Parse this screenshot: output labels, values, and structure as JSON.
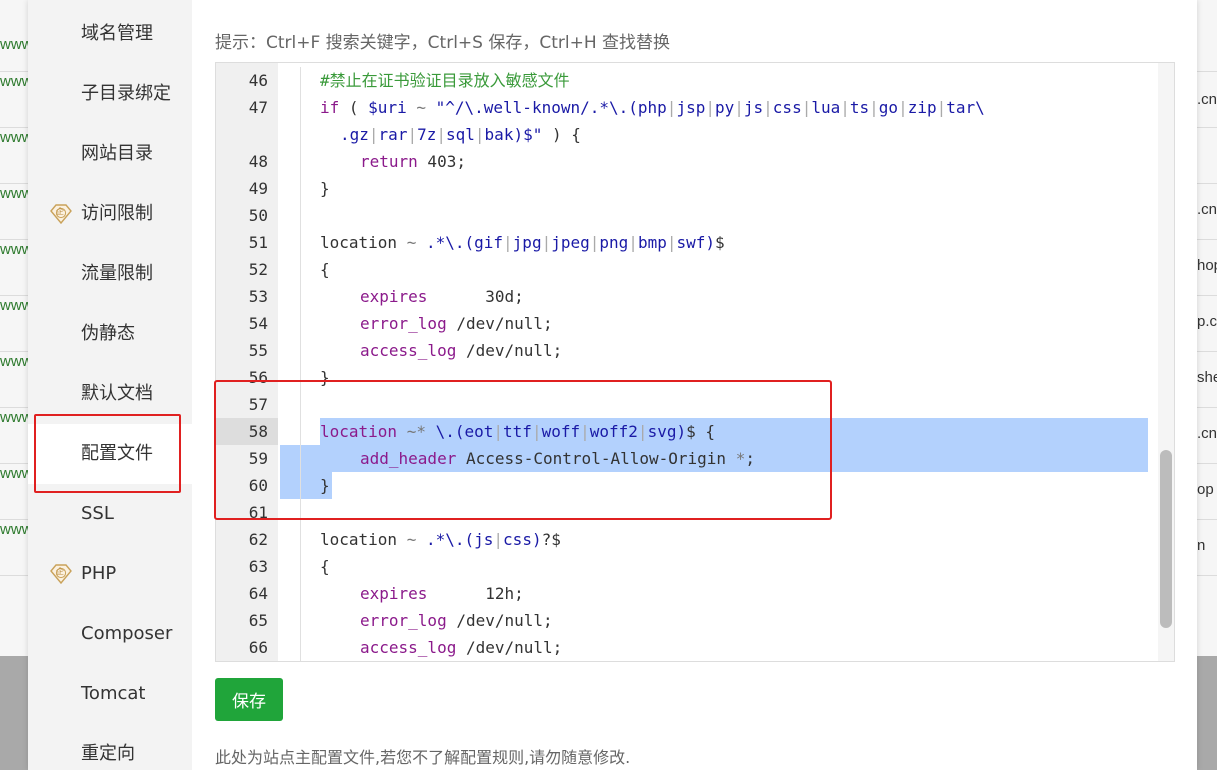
{
  "background": {
    "left_fragments": [
      "www",
      "www",
      "www",
      "www",
      "www",
      "www",
      "www",
      "www",
      "www",
      "www"
    ],
    "right_fragments": [
      ".cn",
      ".cn",
      "hop",
      "p.c",
      "she",
      ".cn",
      "op",
      "n"
    ]
  },
  "sidebar": {
    "items": [
      {
        "label": "域名管理",
        "premium": false,
        "active": false
      },
      {
        "label": "子目录绑定",
        "premium": false,
        "active": false
      },
      {
        "label": "网站目录",
        "premium": false,
        "active": false
      },
      {
        "label": "访问限制",
        "premium": true,
        "active": false
      },
      {
        "label": "流量限制",
        "premium": false,
        "active": false
      },
      {
        "label": "伪静态",
        "premium": false,
        "active": false
      },
      {
        "label": "默认文档",
        "premium": false,
        "active": false
      },
      {
        "label": "配置文件",
        "premium": false,
        "active": true
      },
      {
        "label": "SSL",
        "premium": false,
        "active": false
      },
      {
        "label": "PHP",
        "premium": true,
        "active": false
      },
      {
        "label": "Composer",
        "premium": false,
        "active": false
      },
      {
        "label": "Tomcat",
        "premium": false,
        "active": false
      },
      {
        "label": "重定向",
        "premium": false,
        "active": false
      }
    ],
    "premium_badge": "企"
  },
  "main": {
    "hint": "提示：Ctrl+F 搜索关键字，Ctrl+S 保存，Ctrl+H 查找替换",
    "save_label": "保存",
    "footnote": "此处为站点主配置文件,若您不了解配置规则,请勿随意修改."
  },
  "editor": {
    "current_line": "58",
    "lines": [
      {
        "no": "46",
        "indent": 0,
        "tokens": [
          [
            "comment",
            "#禁止在证书验证目录放入敏感文件"
          ]
        ]
      },
      {
        "no": "47",
        "indent": 0,
        "tokens": [
          [
            "kw",
            "if"
          ],
          [
            "def",
            " ( "
          ],
          [
            "var",
            "$uri"
          ],
          [
            "op",
            " ~ "
          ],
          [
            "str",
            "\"^/\\.well-known/.*\\.(php"
          ],
          [
            "pipe",
            "|"
          ],
          [
            "str",
            "jsp"
          ],
          [
            "pipe",
            "|"
          ],
          [
            "str",
            "py"
          ],
          [
            "pipe",
            "|"
          ],
          [
            "str",
            "js"
          ],
          [
            "pipe",
            "|"
          ],
          [
            "str",
            "css"
          ],
          [
            "pipe",
            "|"
          ],
          [
            "str",
            "lua"
          ],
          [
            "pipe",
            "|"
          ],
          [
            "str",
            "ts"
          ],
          [
            "pipe",
            "|"
          ],
          [
            "str",
            "go"
          ],
          [
            "pipe",
            "|"
          ],
          [
            "str",
            "zip"
          ],
          [
            "pipe",
            "|"
          ],
          [
            "str",
            "tar\\"
          ]
        ]
      },
      {
        "no": "",
        "indent": 0,
        "wrap": true,
        "tokens": [
          [
            "str",
            ".gz"
          ],
          [
            "pipe",
            "|"
          ],
          [
            "str",
            "rar"
          ],
          [
            "pipe",
            "|"
          ],
          [
            "str",
            "7z"
          ],
          [
            "pipe",
            "|"
          ],
          [
            "str",
            "sql"
          ],
          [
            "pipe",
            "|"
          ],
          [
            "str",
            "bak)$\""
          ],
          [
            "def",
            " ) {"
          ]
        ]
      },
      {
        "no": "48",
        "indent": 1,
        "tokens": [
          [
            "kw",
            "return"
          ],
          [
            "def",
            " 403;"
          ]
        ]
      },
      {
        "no": "49",
        "indent": 0,
        "tokens": [
          [
            "def",
            "}"
          ]
        ]
      },
      {
        "no": "50",
        "indent": 0,
        "tokens": []
      },
      {
        "no": "51",
        "indent": 0,
        "tokens": [
          [
            "def",
            "location"
          ],
          [
            "op",
            " ~ "
          ],
          [
            "str",
            ".*\\.(gif"
          ],
          [
            "pipe",
            "|"
          ],
          [
            "str",
            "jpg"
          ],
          [
            "pipe",
            "|"
          ],
          [
            "str",
            "jpeg"
          ],
          [
            "pipe",
            "|"
          ],
          [
            "str",
            "png"
          ],
          [
            "pipe",
            "|"
          ],
          [
            "str",
            "bmp"
          ],
          [
            "pipe",
            "|"
          ],
          [
            "str",
            "swf)"
          ],
          [
            "def",
            "$"
          ]
        ]
      },
      {
        "no": "52",
        "indent": 0,
        "tokens": [
          [
            "def",
            "{"
          ]
        ]
      },
      {
        "no": "53",
        "indent": 1,
        "tokens": [
          [
            "kw",
            "expires"
          ],
          [
            "def",
            "      30d;"
          ]
        ]
      },
      {
        "no": "54",
        "indent": 1,
        "tokens": [
          [
            "kw",
            "error_log"
          ],
          [
            "def",
            " /dev/null;"
          ]
        ]
      },
      {
        "no": "55",
        "indent": 1,
        "tokens": [
          [
            "kw",
            "access_log"
          ],
          [
            "def",
            " /dev/null;"
          ]
        ]
      },
      {
        "no": "56",
        "indent": 0,
        "tokens": [
          [
            "def",
            "}"
          ]
        ]
      },
      {
        "no": "57",
        "indent": 0,
        "tokens": []
      },
      {
        "no": "58",
        "indent": 0,
        "selected": true,
        "tokens": [
          [
            "kw",
            "location"
          ],
          [
            "op",
            " ~* "
          ],
          [
            "str",
            "\\.(eot"
          ],
          [
            "pipe",
            "|"
          ],
          [
            "str",
            "ttf"
          ],
          [
            "pipe",
            "|"
          ],
          [
            "str",
            "woff"
          ],
          [
            "pipe",
            "|"
          ],
          [
            "str",
            "woff2"
          ],
          [
            "pipe",
            "|"
          ],
          [
            "str",
            "svg)"
          ],
          [
            "def",
            "$ {"
          ]
        ]
      },
      {
        "no": "59",
        "indent": 1,
        "selected": true,
        "tokens": [
          [
            "kw",
            "add_header"
          ],
          [
            "def",
            " Access-Control-Allow-Origin "
          ],
          [
            "op",
            "*"
          ],
          [
            "def",
            ";"
          ]
        ]
      },
      {
        "no": "60",
        "indent": 0,
        "selected": true,
        "tokens": [
          [
            "def",
            "}"
          ]
        ]
      },
      {
        "no": "61",
        "indent": 0,
        "tokens": []
      },
      {
        "no": "62",
        "indent": 0,
        "tokens": [
          [
            "def",
            "location"
          ],
          [
            "op",
            " ~ "
          ],
          [
            "str",
            ".*\\.(js"
          ],
          [
            "pipe",
            "|"
          ],
          [
            "str",
            "css)"
          ],
          [
            "def",
            "?$"
          ]
        ]
      },
      {
        "no": "63",
        "indent": 0,
        "tokens": [
          [
            "def",
            "{"
          ]
        ]
      },
      {
        "no": "64",
        "indent": 1,
        "tokens": [
          [
            "kw",
            "expires"
          ],
          [
            "def",
            "      12h;"
          ]
        ]
      },
      {
        "no": "65",
        "indent": 1,
        "tokens": [
          [
            "kw",
            "error_log"
          ],
          [
            "def",
            " /dev/null;"
          ]
        ]
      },
      {
        "no": "66",
        "indent": 1,
        "tokens": [
          [
            "kw",
            "access_log"
          ],
          [
            "def",
            " /dev/null;"
          ]
        ]
      }
    ]
  },
  "colors": {
    "accent_green": "#20a53a",
    "highlight_red": "#e02020",
    "selection": "#b3d1fd"
  }
}
